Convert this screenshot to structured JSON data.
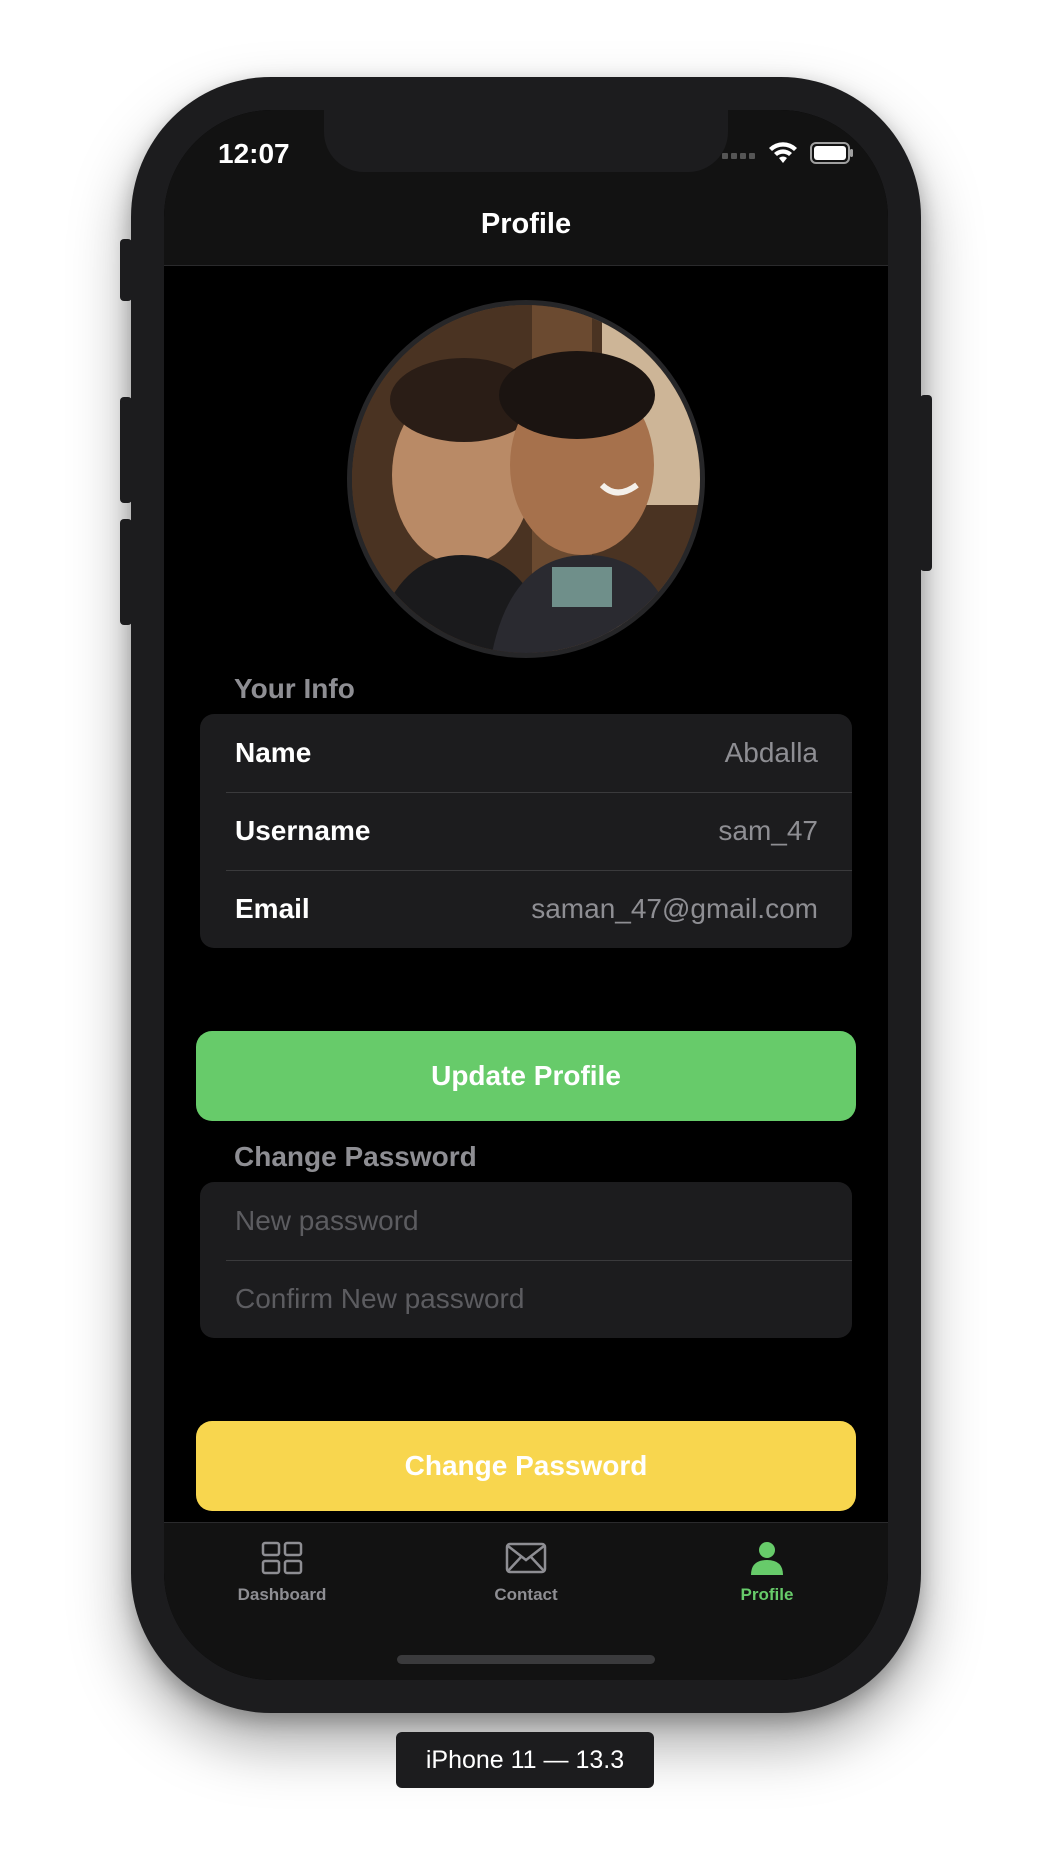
{
  "status_bar": {
    "time": "12:07"
  },
  "nav": {
    "title": "Profile"
  },
  "profile_photo": {
    "description_icon": "profile-photo"
  },
  "your_info": {
    "header": "Your Info",
    "rows": [
      {
        "label": "Name",
        "value": "Abdalla"
      },
      {
        "label": "Username",
        "value": "sam_47"
      },
      {
        "label": "Email",
        "value": "saman_47@gmail.com"
      }
    ]
  },
  "update_button": {
    "label": "Update Profile",
    "color": "#67cb6a"
  },
  "change_password": {
    "header": "Change Password",
    "new_password_placeholder": "New password",
    "confirm_password_placeholder": "Confirm New password"
  },
  "change_password_button": {
    "label": "Change Password",
    "color": "#f8d64e"
  },
  "tabbar": {
    "accent": "#67cb6a",
    "items": [
      {
        "label": "Dashboard",
        "icon": "grid-icon"
      },
      {
        "label": "Contact",
        "icon": "envelope-icon"
      },
      {
        "label": "Profile",
        "icon": "person-icon",
        "selected": true
      }
    ]
  },
  "device_label": "iPhone 11 — 13.3"
}
